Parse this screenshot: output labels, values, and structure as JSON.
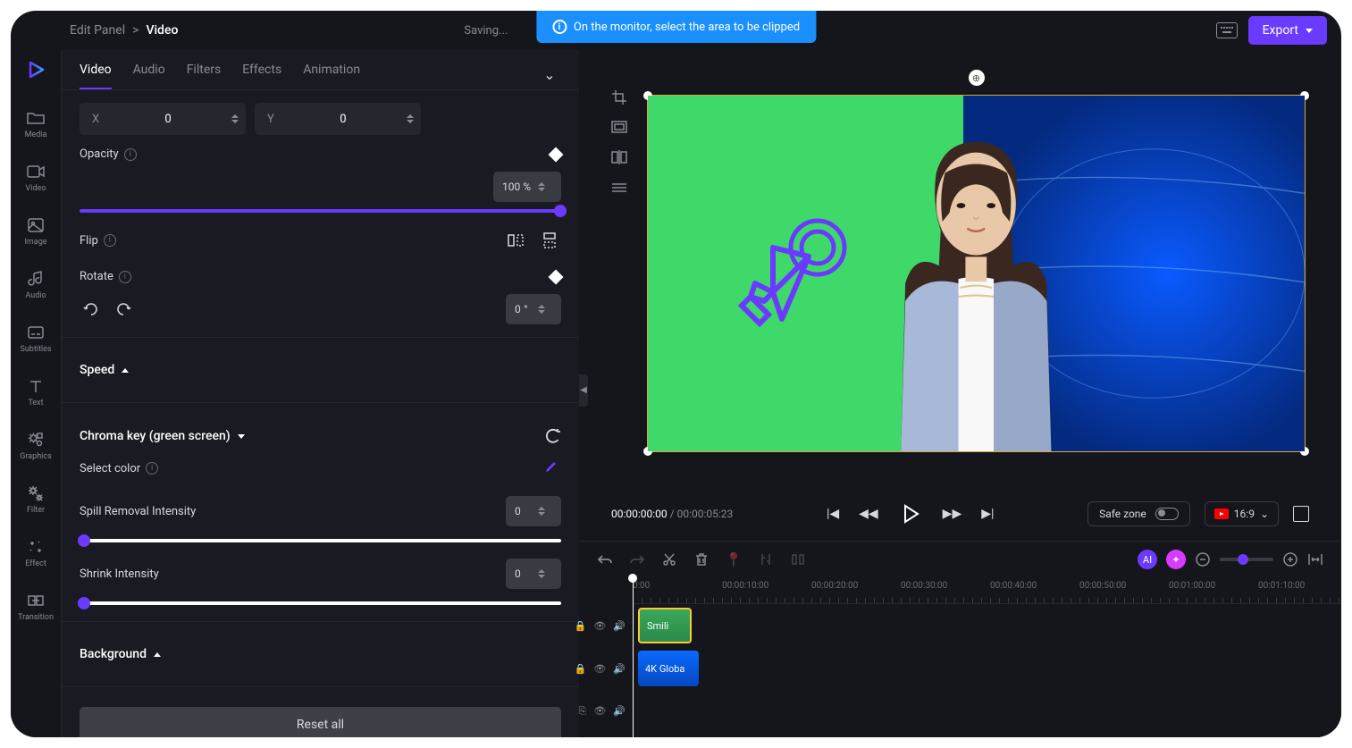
{
  "breadcrumb": {
    "root": "Edit Panel",
    "sep": ">",
    "current": "Video"
  },
  "banner": "On the monitor, select the area to be clipped",
  "saving": "Saving...",
  "export": "Export",
  "sidebar": [
    {
      "label": "Media"
    },
    {
      "label": "Video"
    },
    {
      "label": "Image"
    },
    {
      "label": "Audio"
    },
    {
      "label": "Subtitles"
    },
    {
      "label": "Text"
    },
    {
      "label": "Graphics"
    },
    {
      "label": "Filter"
    },
    {
      "label": "Effect"
    },
    {
      "label": "Transition"
    }
  ],
  "tabs": [
    "Video",
    "Audio",
    "Filters",
    "Effects",
    "Animation"
  ],
  "transform": {
    "x_label": "X",
    "x_value": "0",
    "y_label": "Y",
    "y_value": "0",
    "opacity_label": "Opacity",
    "opacity_value": "100 %",
    "flip_label": "Flip",
    "rotate_label": "Rotate",
    "rotate_value": "0",
    "rotate_unit": "°"
  },
  "speed": {
    "title": "Speed"
  },
  "chroma": {
    "title": "Chroma key (green screen)",
    "select_color": "Select color",
    "spill": "Spill Removal Intensity",
    "spill_val": "0",
    "shrink": "Shrink Intensity",
    "shrink_val": "0"
  },
  "background": {
    "title": "Background"
  },
  "reset": "Reset all",
  "playback": {
    "current": "00:00:00:00",
    "total": "00:00:05:23",
    "safe_zone": "Safe zone",
    "ratio": "16:9"
  },
  "timeline": {
    "times": [
      "0:00",
      "00:00:10:00",
      "00:00:20:00",
      "00:00:30:00",
      "00:00:40:00",
      "00:00:50:00",
      "00:01:00:00",
      "00:01:10:00"
    ],
    "clip1": "Smili",
    "clip2": "4K Globa"
  }
}
